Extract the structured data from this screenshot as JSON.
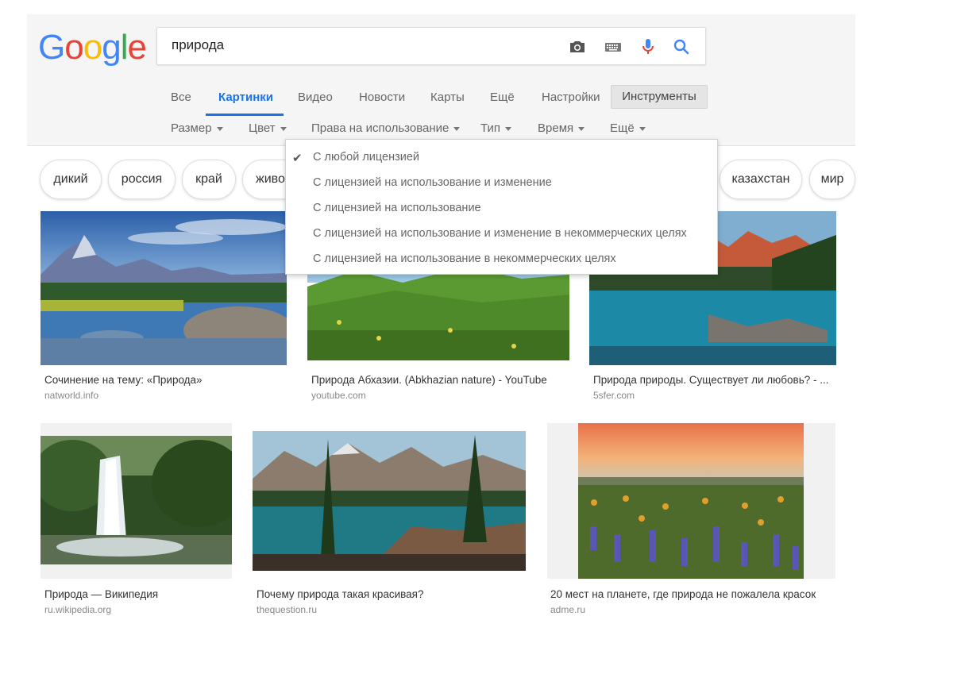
{
  "logo": {
    "letters": [
      "G",
      "o",
      "o",
      "g",
      "l",
      "e"
    ],
    "colors": [
      "#4285F4",
      "#EA4335",
      "#FBBC05",
      "#4285F4",
      "#34A853",
      "#EA4335"
    ]
  },
  "search": {
    "value": "природа"
  },
  "tabs": [
    "Все",
    "Картинки",
    "Видео",
    "Новости",
    "Карты",
    "Ещё",
    "Настройки"
  ],
  "tools_label": "Инструменты",
  "filters": [
    "Размер",
    "Цвет",
    "Права на использование",
    "Тип",
    "Время",
    "Ещё"
  ],
  "chips": [
    "дикий",
    "россия",
    "край",
    "живо",
    "казахстан",
    "мир"
  ],
  "license_menu": {
    "items": [
      "С любой лицензией",
      "С лицензией на использование и изменение",
      "С лицензией на использование",
      "С лицензией на использование и изменение в некоммерческих целях",
      "С лицензией на использование в некоммерческих целях"
    ],
    "selected_index": 0
  },
  "results": [
    {
      "title": "Сочинение на тему: «Природа»",
      "source": "natworld.info"
    },
    {
      "title": "Природа Абхазии. (Abkhazian nature) - YouTube",
      "source": "youtube.com"
    },
    {
      "title": "Природа природы. Существует ли любовь? - ...",
      "source": "5sfer.com"
    },
    {
      "title": "Природа — Википедия",
      "source": "ru.wikipedia.org"
    },
    {
      "title": "Почему природа такая красивая?",
      "source": "thequestion.ru"
    },
    {
      "title": "20 мест на планете, где природа не пожалела красок",
      "source": "adme.ru"
    }
  ],
  "colors": {
    "accent": "#1a73e8",
    "mic_blue": "#4285F4",
    "mic_red": "#EA4335"
  }
}
